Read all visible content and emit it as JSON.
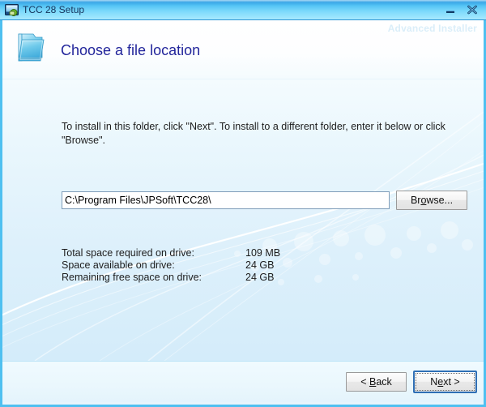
{
  "window": {
    "title": "TCC 28 Setup",
    "title_icon": "setup-app-icon",
    "minimize_label": "minimize-icon",
    "close_label": "close-icon"
  },
  "header": {
    "heading": "Choose a file location",
    "icon": "folder-icon",
    "watermark": "Advanced Installer"
  },
  "body": {
    "instructions": "To install in this folder, click \"Next\". To install to a different folder, enter it below or click \"Browse\".",
    "path_value": "C:\\Program Files\\JPSoft\\TCC28\\",
    "path_placeholder": "",
    "browse_label_before": "Br",
    "browse_accel": "o",
    "browse_label_after": "wse...",
    "space_rows": [
      {
        "label": "Total space required on drive:",
        "value": "109 MB"
      },
      {
        "label": "Space available on drive:",
        "value": "24 GB"
      },
      {
        "label": "Remaining free space on drive:",
        "value": "24 GB"
      }
    ]
  },
  "footer": {
    "back_prefix": "< ",
    "back_accel": "B",
    "back_suffix": "ack",
    "next_prefix": "N",
    "next_accel": "e",
    "next_suffix": "xt >"
  },
  "colors": {
    "titlebar_blue": "#4fc0f0",
    "frame_blue": "#4fc0f0",
    "heading_navy": "#22259b",
    "focus_blue": "#2f6fb5",
    "watermark_blue": "#daeef9"
  }
}
